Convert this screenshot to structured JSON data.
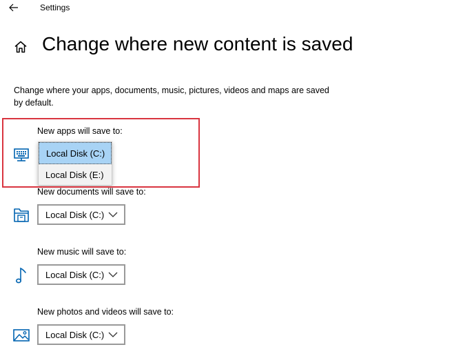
{
  "window": {
    "title": "Settings"
  },
  "header": {
    "title": "Change where new content is saved",
    "description": "Change where your apps, documents, music, pictures, videos and maps are saved by default."
  },
  "sections": [
    {
      "label": "New apps will save to:",
      "value": "Local Disk (C:)",
      "icon": "monitor-icon",
      "open": true,
      "options": [
        "Local Disk (C:)",
        "Local Disk (E:)"
      ],
      "selected_index": 0
    },
    {
      "label": "New documents will save to:",
      "value": "Local Disk (C:)",
      "icon": "documents-folder-icon"
    },
    {
      "label": "New music will save to:",
      "value": "Local Disk (C:)",
      "icon": "music-note-icon"
    },
    {
      "label": "New photos and videos will save to:",
      "value": "Local Disk (C:)",
      "icon": "photo-icon"
    }
  ],
  "colors": {
    "accent": "#0063b1",
    "highlight": "#d9343f",
    "selected_option": "#a8d3f5",
    "dropdown_border": "#999999"
  }
}
